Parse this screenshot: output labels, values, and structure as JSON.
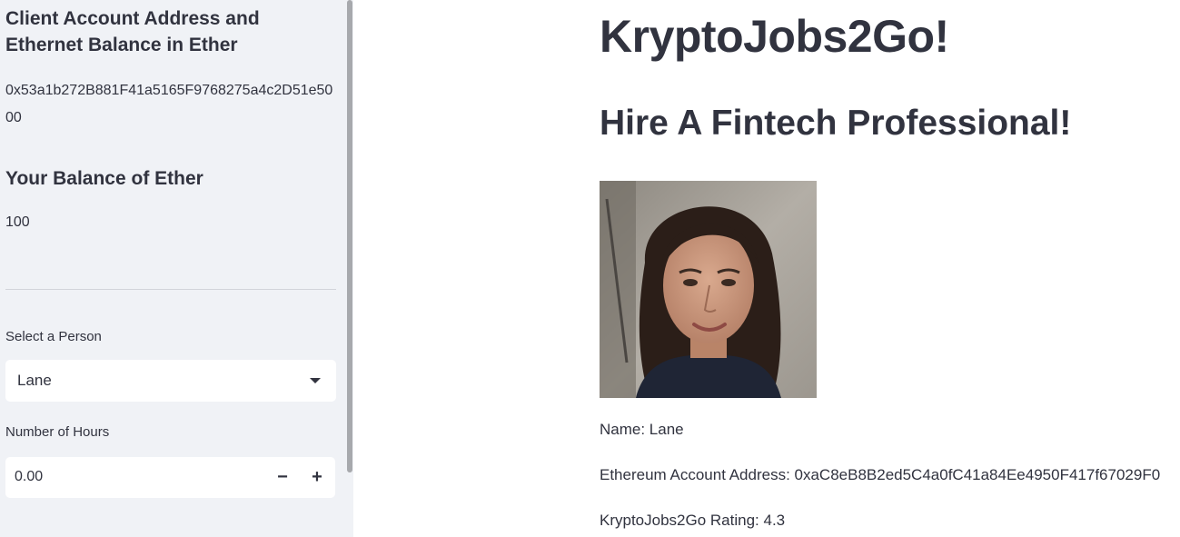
{
  "sidebar": {
    "account_heading": "Client Account Address and Ethernet Balance in Ether",
    "account_address": "0x53a1b272B881F41a5165F9768275a4c2D51e5000",
    "balance_heading": "Your Balance of Ether",
    "balance_value": "100",
    "person_label": "Select a Person",
    "person_selected": "Lane",
    "hours_label": "Number of Hours",
    "hours_value": "0.00",
    "minus_label": "−",
    "plus_label": "+"
  },
  "main": {
    "title": "KryptoJobs2Go!",
    "subtitle": "Hire A Fintech Professional!",
    "name_line": "Name: Lane",
    "address_line": "Ethereum Account Address: 0xaC8eB8B2ed5C4a0fC41a84Ee4950F417f67029F0",
    "rating_line": "KryptoJobs2Go Rating: 4.3"
  },
  "icons": {
    "select_chevron": "chevron-down-icon",
    "portrait": "person-portrait"
  },
  "colors": {
    "sidebar_bg": "#f0f2f6",
    "text": "#31333f",
    "input_bg": "#ffffff"
  }
}
